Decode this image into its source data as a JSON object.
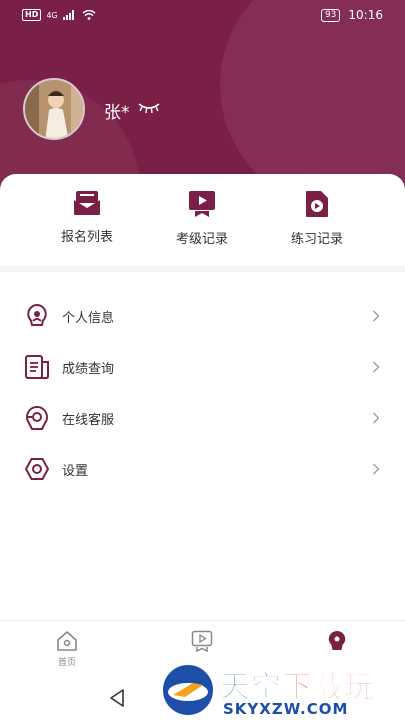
{
  "status_bar": {
    "network_badge": "HD",
    "signal_label": "4G",
    "battery": "93",
    "time": "10:16"
  },
  "profile": {
    "name": "张*"
  },
  "quick_actions": [
    {
      "label": "报名列表",
      "icon": "envelope-icon"
    },
    {
      "label": "考级记录",
      "icon": "video-record-icon"
    },
    {
      "label": "练习记录",
      "icon": "play-document-icon"
    }
  ],
  "menu": [
    {
      "label": "个人信息",
      "icon": "user-bulb-icon"
    },
    {
      "label": "成绩查询",
      "icon": "document-list-icon"
    },
    {
      "label": "在线客服",
      "icon": "headset-icon"
    },
    {
      "label": "设置",
      "icon": "hexagon-settings-icon"
    }
  ],
  "tabbar": [
    {
      "label": "首页",
      "icon": "home-icon"
    },
    {
      "label": "",
      "icon": "video-tab-icon"
    },
    {
      "label": "",
      "icon": "profile-tab-icon"
    }
  ],
  "watermark": {
    "title_a": "天空",
    "title_b": "下载玩",
    "subtitle": "SKYXZW.COM"
  },
  "colors": {
    "brand": "#7a1f45",
    "text": "#333333",
    "muted": "#888888"
  }
}
